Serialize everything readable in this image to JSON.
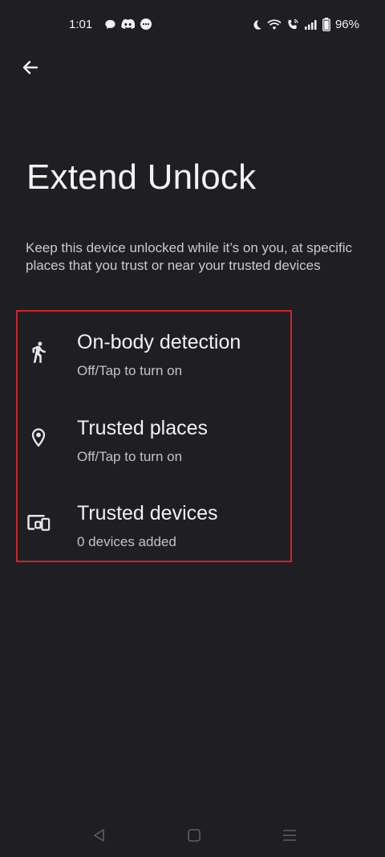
{
  "status_bar": {
    "time": "1:01",
    "battery_percent": "96%",
    "left_icons": [
      "chat-bubble-icon",
      "discord-icon",
      "messages-icon"
    ],
    "right_icons": [
      "moon-icon",
      "wifi-icon",
      "wifi-calling-icon",
      "signal-icon",
      "battery-icon"
    ]
  },
  "header": {
    "back_icon": "arrow-left-icon",
    "title": "Extend Unlock",
    "description": "Keep this device unlocked while it’s on you, at specific places that you trust or near your trusted devices"
  },
  "settings": {
    "items": [
      {
        "title": "On-body detection",
        "subtitle": "Off/Tap to turn on",
        "icon": "walking-person-icon"
      },
      {
        "title": "Trusted places",
        "subtitle": "Off/Tap to turn on",
        "icon": "location-pin-icon"
      },
      {
        "title": "Trusted devices",
        "subtitle": "0 devices added",
        "icon": "devices-icon"
      }
    ]
  },
  "nav_bar": {
    "buttons": [
      "back-triangle-icon",
      "home-square-icon",
      "recents-menu-icon"
    ]
  },
  "colors": {
    "background": "#1f1f23",
    "highlight": "#d2222a",
    "text_primary": "#f1f1f4",
    "text_secondary": "#c2c2c7"
  }
}
